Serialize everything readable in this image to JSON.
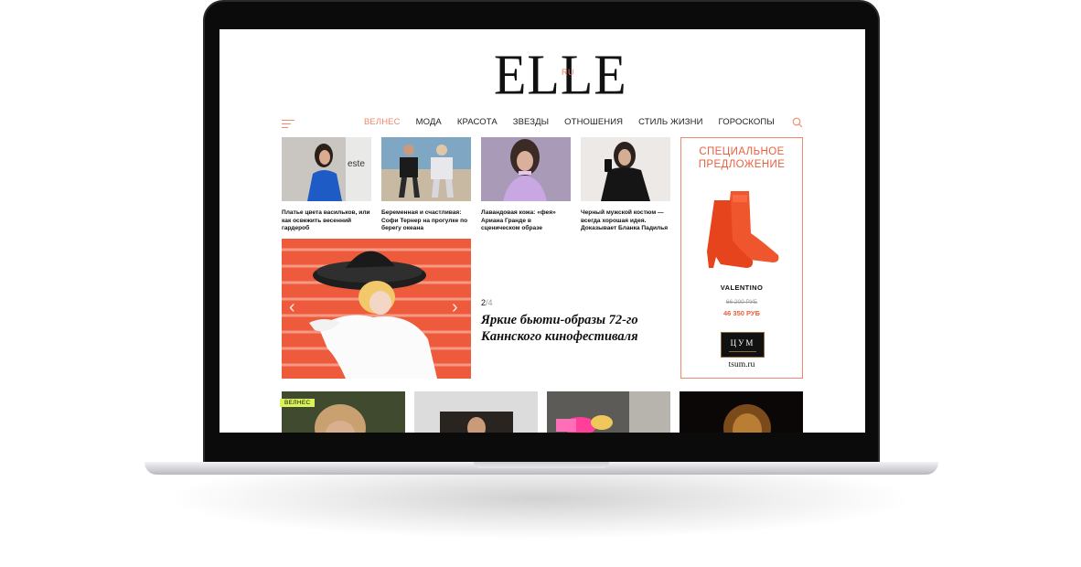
{
  "site": {
    "logo": "ELLE",
    "logo_suffix": "RU"
  },
  "nav": {
    "items": [
      "ВЕЛНЕС",
      "МОДА",
      "КРАСОТА",
      "ЗВЕЗДЫ",
      "ОТНОШЕНИЯ",
      "СТИЛЬ ЖИЗНИ",
      "ГОРОСКОПЫ"
    ],
    "active": "ВЕЛНЕС"
  },
  "top_stories": [
    {
      "caption": "Платье цвета васильков, или как освежить весенний гардероб"
    },
    {
      "caption": "Беременная и счастливая: Софи Тернер на прогулке по берегу океана"
    },
    {
      "caption": "Лавандовая кожа: «фея» Ариана Гранде в сценическом образе"
    },
    {
      "caption": "Черный мужской костюм — всегда хорошая идея. Доказывает Бланка Падилья"
    }
  ],
  "slider": {
    "current": "2",
    "separator": "/",
    "total": "4",
    "headline": "Яркие бьюти-образы 72-го Каннского кинофестиваля"
  },
  "ad": {
    "title": "СПЕЦИАЛЬНОЕ ПРЕДЛОЖЕНИЕ",
    "brand": "VALENTINO",
    "old_price": "66 200 РУБ",
    "new_price": "46 350 РУБ",
    "store_logo": "ЦУМ",
    "store_url": "tsum.ru"
  },
  "bottom": {
    "badge": "ВЕЛНЕС"
  },
  "colors": {
    "accent": "#f08a6e",
    "badge": "#d9f45a"
  },
  "icons": [
    "menu-icon",
    "search-icon",
    "chevron-left-icon",
    "chevron-right-icon"
  ]
}
